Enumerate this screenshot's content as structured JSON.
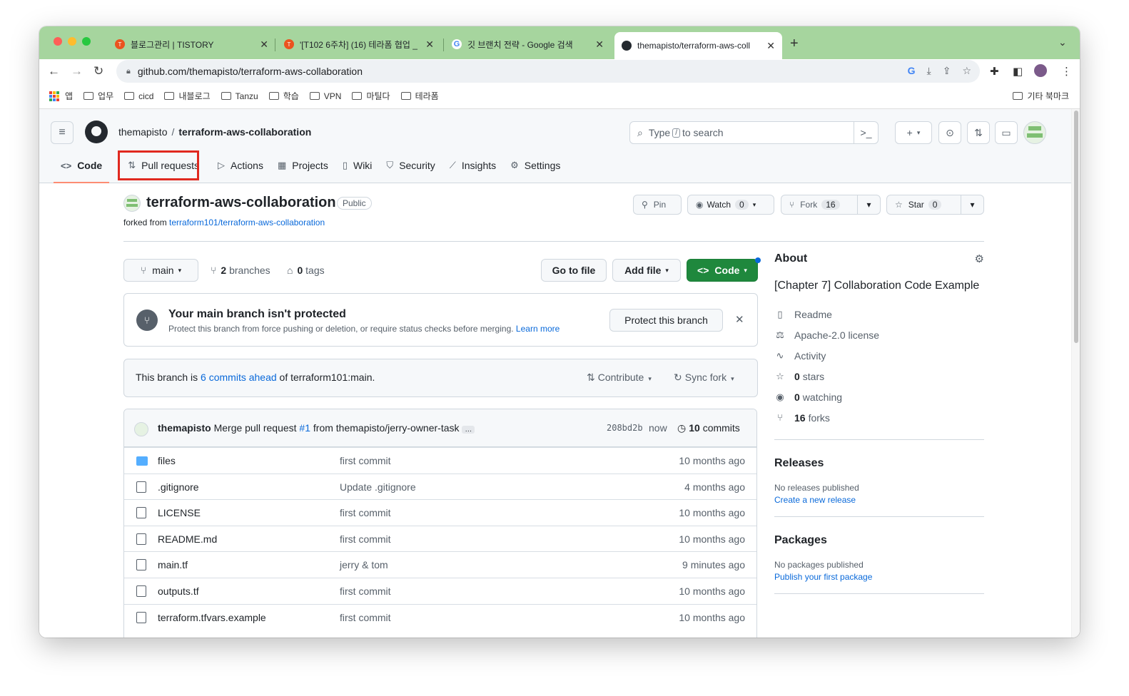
{
  "browser": {
    "tabs": [
      {
        "title": "블로그관리 | TISTORY",
        "favicon": "tistory-icon"
      },
      {
        "title": "'[T102 6주차] (16) 테라폼 협업 _ ",
        "favicon": "tistory-icon"
      },
      {
        "title": "깃 브랜치 전략 - Google 검색",
        "favicon": "google-icon"
      },
      {
        "title": "themapisto/terraform-aws-coll",
        "favicon": "github-icon"
      }
    ],
    "url": "github.com/themapisto/terraform-aws-collaboration",
    "bookmarks": [
      "앱",
      "업무",
      "cicd",
      "내블로그",
      "Tanzu",
      "학습",
      "VPN",
      "마틸다",
      "테라폼"
    ],
    "other_bookmarks": "기타 북마크"
  },
  "header": {
    "owner": "themapisto",
    "separator": "/",
    "repo": "terraform-aws-collaboration",
    "search_prefix": "Type",
    "search_key": "/",
    "search_suffix": "to search",
    "plus": "+"
  },
  "reponav": [
    {
      "label": "Code",
      "icon": "<>"
    },
    {
      "label": "Pull requests",
      "icon": "⇅"
    },
    {
      "label": "Actions",
      "icon": "▷"
    },
    {
      "label": "Projects",
      "icon": "▦"
    },
    {
      "label": "Wiki",
      "icon": "▯"
    },
    {
      "label": "Security",
      "icon": "⛉"
    },
    {
      "label": "Insights",
      "icon": "⟋"
    },
    {
      "label": "Settings",
      "icon": "⚙"
    }
  ],
  "repo": {
    "name": "terraform-aws-collaboration",
    "visibility": "Public",
    "forked_prefix": "forked from",
    "forked_link": "terraform101/terraform-aws-collaboration",
    "pin": "Pin",
    "watch": "Watch",
    "watch_count": "0",
    "fork": "Fork",
    "fork_count": "16",
    "star": "Star",
    "star_count": "0"
  },
  "branchbar": {
    "branch": "main",
    "branches_count": "2",
    "branches_label": "branches",
    "tags_count": "0",
    "tags_label": "tags",
    "goto": "Go to file",
    "addfile": "Add file",
    "code": "Code"
  },
  "protect": {
    "title": "Your main branch isn't protected",
    "desc": "Protect this branch from force pushing or deletion, or require status checks before merging.",
    "learn": "Learn more",
    "button": "Protect this branch"
  },
  "ahead": {
    "prefix": "This branch is",
    "link": "6 commits ahead",
    "suffix": "of terraform101:main.",
    "contribute": "Contribute",
    "sync": "Sync fork"
  },
  "commit": {
    "author": "themapisto",
    "msg_prefix": "Merge pull request",
    "pr": "#1",
    "msg_suffix": "from themapisto/jerry-owner-task",
    "ellipsis": "…",
    "sha": "208bd2b",
    "time": "now",
    "count": "10",
    "count_label": "commits"
  },
  "files": [
    {
      "name": "files",
      "type": "dir",
      "msg": "first commit",
      "age": "10 months ago"
    },
    {
      "name": ".gitignore",
      "type": "file",
      "msg": "Update .gitignore",
      "age": "4 months ago"
    },
    {
      "name": "LICENSE",
      "type": "file",
      "msg": "first commit",
      "age": "10 months ago"
    },
    {
      "name": "README.md",
      "type": "file",
      "msg": "first commit",
      "age": "10 months ago"
    },
    {
      "name": "main.tf",
      "type": "file",
      "msg": "jerry & tom",
      "age": "9 minutes ago"
    },
    {
      "name": "outputs.tf",
      "type": "file",
      "msg": "first commit",
      "age": "10 months ago"
    },
    {
      "name": "terraform.tfvars.example",
      "type": "file",
      "msg": "first commit",
      "age": "10 months ago"
    }
  ],
  "about": {
    "title": "About",
    "desc": "[Chapter 7] Collaboration Code Example",
    "readme": "Readme",
    "license": "Apache-2.0 license",
    "activity": "Activity",
    "stars_count": "0",
    "stars_label": "stars",
    "watching_count": "0",
    "watching_label": "watching",
    "forks_count": "16",
    "forks_label": "forks"
  },
  "releases": {
    "title": "Releases",
    "none": "No releases published",
    "create": "Create a new release"
  },
  "packages": {
    "title": "Packages",
    "none": "No packages published",
    "publish": "Publish your first package"
  },
  "colors": {
    "accent_green": "#1f883d",
    "link": "#0969da",
    "highlight": "#e0291f",
    "chrome": "#a6d59e"
  }
}
